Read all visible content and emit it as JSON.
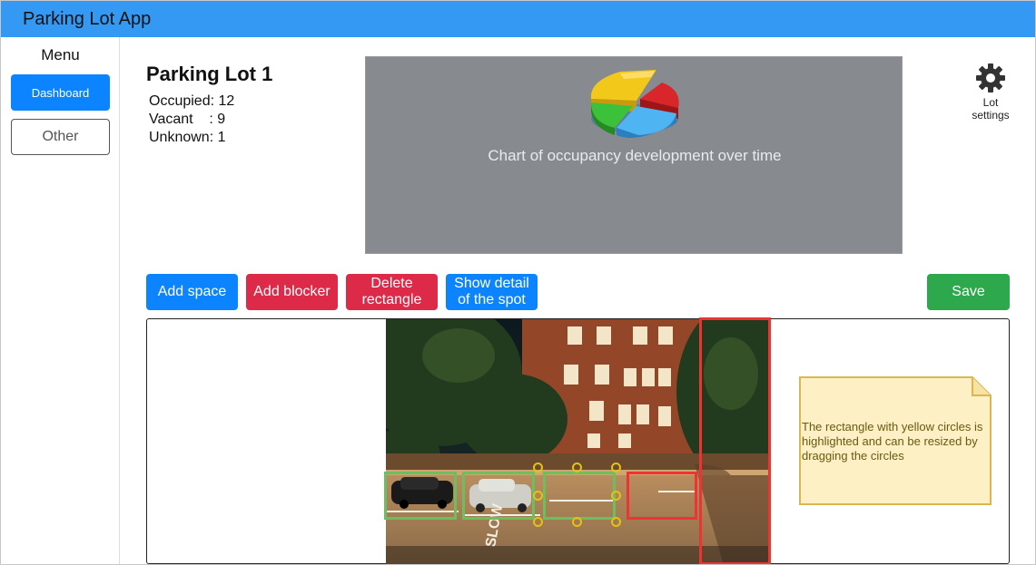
{
  "app": {
    "title": "Parking Lot App"
  },
  "sidebar": {
    "menu_title": "Menu",
    "items": [
      {
        "label": "Dashboard",
        "active": true
      },
      {
        "label": "Other",
        "active": false
      }
    ]
  },
  "lot": {
    "title": "Parking Lot 1",
    "stats": [
      {
        "text": "Occupied: 12"
      },
      {
        "text": "Vacant    : 9"
      },
      {
        "text": "Unknown: 1"
      }
    ]
  },
  "chart_panel": {
    "caption": "Chart of occupancy development over time",
    "icon": "pie-chart-icon"
  },
  "settings": {
    "icon": "gear-icon",
    "label_line1": "Lot",
    "label_line2": "settings"
  },
  "toolbar": {
    "add_space": "Add space",
    "add_blocker": "Add blocker",
    "delete_line1": "Delete",
    "delete_line2": "rectangle",
    "detail_line1": "Show detail",
    "detail_line2": "of the spot",
    "save": "Save"
  },
  "note": {
    "text": "The rectangle with yellow circles is highlighted and can be resized by dragging the circles"
  },
  "colors": {
    "header": "#3399f3",
    "primary": "#0d84ff",
    "danger": "#dd2a48",
    "success": "#2ea84c",
    "spot_green": "#6cbf5c",
    "spot_red": "#ee3333",
    "handle_yellow": "#e3c214",
    "note_fill": "#fdf0c4"
  }
}
